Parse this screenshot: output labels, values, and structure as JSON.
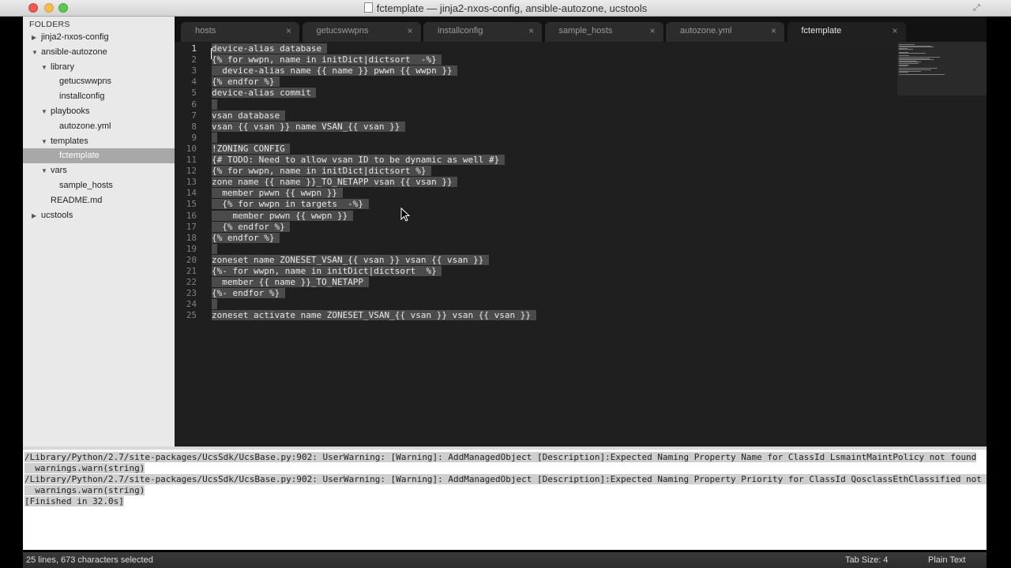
{
  "window": {
    "title": "fctemplate — jinja2-nxos-config, ansible-autozone, ucstools"
  },
  "sidebar": {
    "header": "FOLDERS",
    "nodes": [
      {
        "label": "jinja2-nxos-config",
        "depth": 0,
        "kind": "folder",
        "expanded": false
      },
      {
        "label": "ansible-autozone",
        "depth": 0,
        "kind": "folder",
        "expanded": true
      },
      {
        "label": "library",
        "depth": 1,
        "kind": "folder",
        "expanded": true
      },
      {
        "label": "getucswwpns",
        "depth": 2,
        "kind": "file"
      },
      {
        "label": "installconfig",
        "depth": 2,
        "kind": "file"
      },
      {
        "label": "playbooks",
        "depth": 1,
        "kind": "folder",
        "expanded": true
      },
      {
        "label": "autozone.yml",
        "depth": 2,
        "kind": "file"
      },
      {
        "label": "templates",
        "depth": 1,
        "kind": "folder",
        "expanded": true
      },
      {
        "label": "fctemplate",
        "depth": 2,
        "kind": "file",
        "selected": true
      },
      {
        "label": "vars",
        "depth": 1,
        "kind": "folder",
        "expanded": true
      },
      {
        "label": "sample_hosts",
        "depth": 2,
        "kind": "file"
      },
      {
        "label": "README.md",
        "depth": 1,
        "kind": "file"
      },
      {
        "label": "ucstools",
        "depth": 0,
        "kind": "folder",
        "expanded": false
      }
    ]
  },
  "tabs": [
    {
      "label": "hosts",
      "close": "×"
    },
    {
      "label": "getucswwpns",
      "close": "×"
    },
    {
      "label": "installconfig",
      "close": "×"
    },
    {
      "label": "sample_hosts",
      "close": "×"
    },
    {
      "label": "autozone.yml",
      "close": "×"
    },
    {
      "label": "fctemplate",
      "close": "×",
      "active": true
    }
  ],
  "editor": {
    "lines": [
      "device-alias database",
      "{% for wwpn, name in initDict|dictsort  -%}",
      "  device-alias name {{ name }} pwwn {{ wwpn }}",
      "{% endfor %}",
      "device-alias commit",
      "",
      "vsan database",
      "vsan {{ vsan }} name VSAN_{{ vsan }}",
      "",
      "!ZONING CONFIG",
      "{# TODO: Need to allow vsan ID to be dynamic as well #}",
      "{% for wwpn, name in initDict|dictsort %}",
      "zone name {{ name }}_TO_NETAPP vsan {{ vsan }}",
      "  member pwwn {{ wwpn }}",
      "  {% for wwpn in targets  -%}",
      "    member pwwn {{ wwpn }}",
      "  {% endfor %}",
      "{% endfor %}",
      "",
      "zoneset name ZONESET_VSAN_{{ vsan }} vsan {{ vsan }}",
      "{%- for wwpn, name in initDict|dictsort  %}",
      "  member {{ name }}_TO_NETAPP",
      "{%- endfor %}",
      "",
      "zoneset activate name ZONESET_VSAN_{{ vsan }} vsan {{ vsan }}"
    ]
  },
  "output": {
    "lines": [
      "/Library/Python/2.7/site-packages/UcsSdk/UcsBase.py:902: UserWarning: [Warning]: AddManagedObject [Description]:Expected Naming Property Name for ClassId LsmaintMaintPolicy not found",
      "  warnings.warn(string)",
      "/Library/Python/2.7/site-packages/UcsSdk/UcsBase.py:902: UserWarning: [Warning]: AddManagedObject [Description]:Expected Naming Property Priority for ClassId QosclassEthClassified not found",
      "  warnings.warn(string)",
      "[Finished in 32.0s]"
    ]
  },
  "status": {
    "selection": "25 lines, 673 characters selected",
    "tab_size": "Tab Size: 4",
    "syntax": "Plain Text"
  },
  "colors": {
    "editor_bg": "#1f1f1f",
    "selection": "#4b4b4b",
    "sidebar_bg": "#e9e9e9",
    "sidebar_selected": "#a8a8a8"
  },
  "icons": {
    "close": "close-icon",
    "expanded": "triangle-down-icon",
    "collapsed": "triangle-right-icon",
    "fullscreen": "fullscreen-icon",
    "document": "document-icon"
  }
}
